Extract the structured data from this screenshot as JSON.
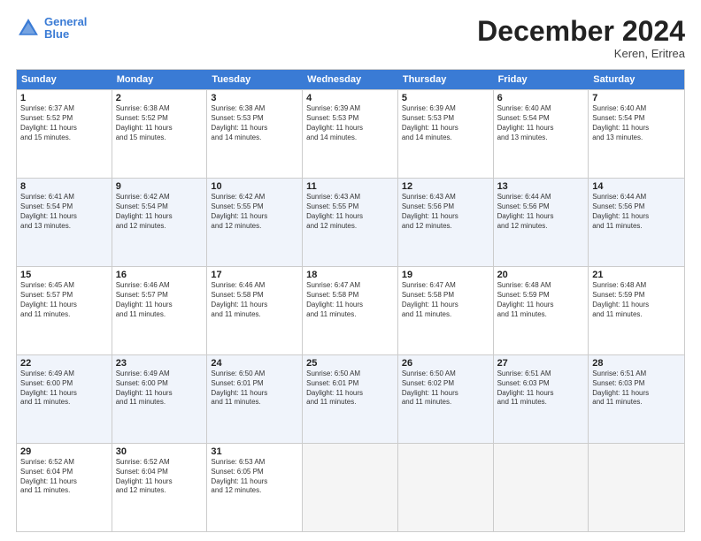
{
  "header": {
    "logo_line1": "General",
    "logo_line2": "Blue",
    "month": "December 2024",
    "location": "Keren, Eritrea"
  },
  "days_of_week": [
    "Sunday",
    "Monday",
    "Tuesday",
    "Wednesday",
    "Thursday",
    "Friday",
    "Saturday"
  ],
  "weeks": [
    [
      {
        "day": "1",
        "info": "Sunrise: 6:37 AM\nSunset: 5:52 PM\nDaylight: 11 hours\nand 15 minutes.",
        "empty": false
      },
      {
        "day": "2",
        "info": "Sunrise: 6:38 AM\nSunset: 5:52 PM\nDaylight: 11 hours\nand 15 minutes.",
        "empty": false
      },
      {
        "day": "3",
        "info": "Sunrise: 6:38 AM\nSunset: 5:53 PM\nDaylight: 11 hours\nand 14 minutes.",
        "empty": false
      },
      {
        "day": "4",
        "info": "Sunrise: 6:39 AM\nSunset: 5:53 PM\nDaylight: 11 hours\nand 14 minutes.",
        "empty": false
      },
      {
        "day": "5",
        "info": "Sunrise: 6:39 AM\nSunset: 5:53 PM\nDaylight: 11 hours\nand 14 minutes.",
        "empty": false
      },
      {
        "day": "6",
        "info": "Sunrise: 6:40 AM\nSunset: 5:54 PM\nDaylight: 11 hours\nand 13 minutes.",
        "empty": false
      },
      {
        "day": "7",
        "info": "Sunrise: 6:40 AM\nSunset: 5:54 PM\nDaylight: 11 hours\nand 13 minutes.",
        "empty": false
      }
    ],
    [
      {
        "day": "8",
        "info": "Sunrise: 6:41 AM\nSunset: 5:54 PM\nDaylight: 11 hours\nand 13 minutes.",
        "empty": false
      },
      {
        "day": "9",
        "info": "Sunrise: 6:42 AM\nSunset: 5:54 PM\nDaylight: 11 hours\nand 12 minutes.",
        "empty": false
      },
      {
        "day": "10",
        "info": "Sunrise: 6:42 AM\nSunset: 5:55 PM\nDaylight: 11 hours\nand 12 minutes.",
        "empty": false
      },
      {
        "day": "11",
        "info": "Sunrise: 6:43 AM\nSunset: 5:55 PM\nDaylight: 11 hours\nand 12 minutes.",
        "empty": false
      },
      {
        "day": "12",
        "info": "Sunrise: 6:43 AM\nSunset: 5:56 PM\nDaylight: 11 hours\nand 12 minutes.",
        "empty": false
      },
      {
        "day": "13",
        "info": "Sunrise: 6:44 AM\nSunset: 5:56 PM\nDaylight: 11 hours\nand 12 minutes.",
        "empty": false
      },
      {
        "day": "14",
        "info": "Sunrise: 6:44 AM\nSunset: 5:56 PM\nDaylight: 11 hours\nand 11 minutes.",
        "empty": false
      }
    ],
    [
      {
        "day": "15",
        "info": "Sunrise: 6:45 AM\nSunset: 5:57 PM\nDaylight: 11 hours\nand 11 minutes.",
        "empty": false
      },
      {
        "day": "16",
        "info": "Sunrise: 6:46 AM\nSunset: 5:57 PM\nDaylight: 11 hours\nand 11 minutes.",
        "empty": false
      },
      {
        "day": "17",
        "info": "Sunrise: 6:46 AM\nSunset: 5:58 PM\nDaylight: 11 hours\nand 11 minutes.",
        "empty": false
      },
      {
        "day": "18",
        "info": "Sunrise: 6:47 AM\nSunset: 5:58 PM\nDaylight: 11 hours\nand 11 minutes.",
        "empty": false
      },
      {
        "day": "19",
        "info": "Sunrise: 6:47 AM\nSunset: 5:58 PM\nDaylight: 11 hours\nand 11 minutes.",
        "empty": false
      },
      {
        "day": "20",
        "info": "Sunrise: 6:48 AM\nSunset: 5:59 PM\nDaylight: 11 hours\nand 11 minutes.",
        "empty": false
      },
      {
        "day": "21",
        "info": "Sunrise: 6:48 AM\nSunset: 5:59 PM\nDaylight: 11 hours\nand 11 minutes.",
        "empty": false
      }
    ],
    [
      {
        "day": "22",
        "info": "Sunrise: 6:49 AM\nSunset: 6:00 PM\nDaylight: 11 hours\nand 11 minutes.",
        "empty": false
      },
      {
        "day": "23",
        "info": "Sunrise: 6:49 AM\nSunset: 6:00 PM\nDaylight: 11 hours\nand 11 minutes.",
        "empty": false
      },
      {
        "day": "24",
        "info": "Sunrise: 6:50 AM\nSunset: 6:01 PM\nDaylight: 11 hours\nand 11 minutes.",
        "empty": false
      },
      {
        "day": "25",
        "info": "Sunrise: 6:50 AM\nSunset: 6:01 PM\nDaylight: 11 hours\nand 11 minutes.",
        "empty": false
      },
      {
        "day": "26",
        "info": "Sunrise: 6:50 AM\nSunset: 6:02 PM\nDaylight: 11 hours\nand 11 minutes.",
        "empty": false
      },
      {
        "day": "27",
        "info": "Sunrise: 6:51 AM\nSunset: 6:03 PM\nDaylight: 11 hours\nand 11 minutes.",
        "empty": false
      },
      {
        "day": "28",
        "info": "Sunrise: 6:51 AM\nSunset: 6:03 PM\nDaylight: 11 hours\nand 11 minutes.",
        "empty": false
      }
    ],
    [
      {
        "day": "29",
        "info": "Sunrise: 6:52 AM\nSunset: 6:04 PM\nDaylight: 11 hours\nand 11 minutes.",
        "empty": false
      },
      {
        "day": "30",
        "info": "Sunrise: 6:52 AM\nSunset: 6:04 PM\nDaylight: 11 hours\nand 12 minutes.",
        "empty": false
      },
      {
        "day": "31",
        "info": "Sunrise: 6:53 AM\nSunset: 6:05 PM\nDaylight: 11 hours\nand 12 minutes.",
        "empty": false
      },
      {
        "day": "",
        "info": "",
        "empty": true
      },
      {
        "day": "",
        "info": "",
        "empty": true
      },
      {
        "day": "",
        "info": "",
        "empty": true
      },
      {
        "day": "",
        "info": "",
        "empty": true
      }
    ]
  ]
}
